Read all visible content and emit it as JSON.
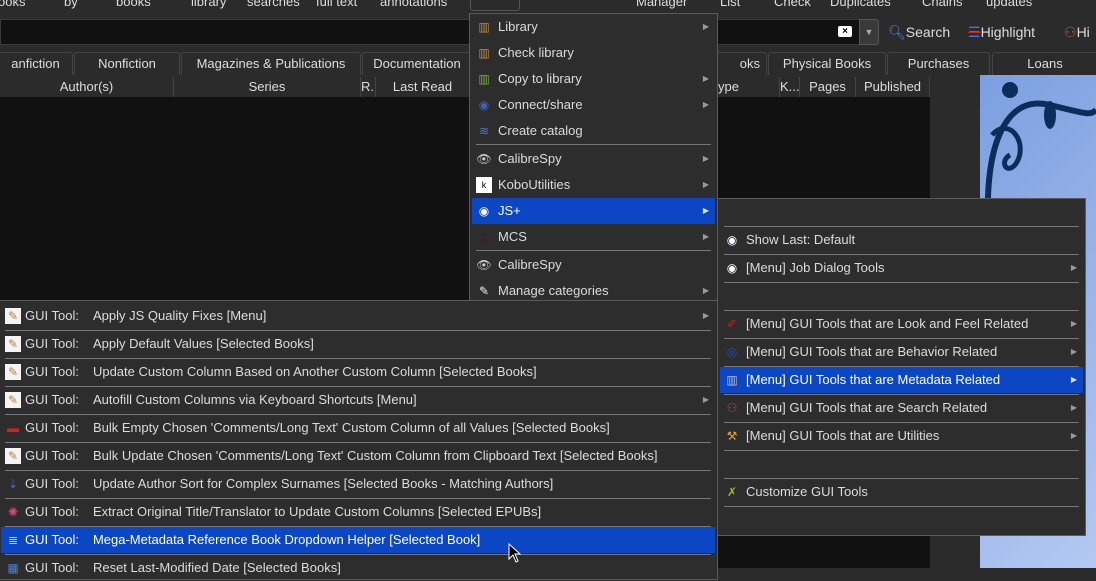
{
  "toolbar": {
    "items": [
      "ooks",
      "by",
      "books",
      "library",
      "searches",
      "full text",
      "annotations",
      "Manager",
      "List",
      "Check",
      "Duplicates",
      "Chains",
      "updates"
    ],
    "search_label": "Search",
    "highlight_label": "Highlight",
    "hi_label": "Hi",
    "clear_icon": "clear-x-icon"
  },
  "tabs": [
    "anfiction",
    "Nonfiction",
    "Magazines & Publications",
    "Documentation",
    "oks",
    "Physical Books",
    "Purchases",
    "Loans"
  ],
  "columns": [
    "Author(s)",
    "Series",
    "R...",
    "Last Read",
    "ype",
    "K...",
    "Pages",
    "Published"
  ],
  "main_menu": [
    {
      "label": "Library",
      "icon": "library-icon",
      "submenu": true
    },
    {
      "label": "Check library",
      "icon": "library-icon"
    },
    {
      "label": "Copy to library",
      "icon": "copy-library-icon",
      "submenu": true
    },
    {
      "label": "Connect/share",
      "icon": "connect-icon",
      "submenu": true
    },
    {
      "label": "Create catalog",
      "icon": "catalog-icon"
    },
    {
      "label": "CalibreSpy",
      "icon": "spy-icon",
      "submenu": true
    },
    {
      "label": "KoboUtilities",
      "icon": "kobo-icon",
      "submenu": true
    },
    {
      "label": "JS+",
      "icon": "eye-icon",
      "submenu": true,
      "selected": true
    },
    {
      "label": "MCS",
      "icon": "mcs-icon",
      "submenu": true
    },
    {
      "label": "CalibreSpy",
      "icon": "spy-icon"
    },
    {
      "label": "Manage categories",
      "icon": "tag-icon",
      "submenu": true
    }
  ],
  "jsplus_menu": [
    {
      "label": "Show Last: Default",
      "icon": "eye-icon"
    },
    {
      "label": "[Menu] Job Dialog Tools",
      "icon": "eye-icon",
      "submenu": true
    },
    {
      "label": "[Menu] GUI Tools that are Look and Feel Related",
      "icon": "brush-icon",
      "submenu": true
    },
    {
      "label": "[Menu] GUI Tools that are Behavior Related",
      "icon": "behavior-icon",
      "submenu": true
    },
    {
      "label": "[Menu] GUI Tools that are Metadata Related",
      "icon": "column-icon",
      "submenu": true,
      "selected": true
    },
    {
      "label": "[Menu] GUI Tools that are Search Related",
      "icon": "binoculars-icon",
      "submenu": true
    },
    {
      "label": "[Menu] GUI Tools that are Utilities",
      "icon": "tools-icon",
      "submenu": true
    },
    {
      "label": "Customize GUI Tools",
      "icon": "customize-icon"
    }
  ],
  "gui_menu": {
    "prefix": "GUI Tool:",
    "items": [
      {
        "label": "Apply JS Quality Fixes [Menu]",
        "icon": "pencil-icon",
        "submenu": true
      },
      {
        "label": "Apply Default Values [Selected Books]",
        "icon": "pencil-icon"
      },
      {
        "label": "Update Custom Column Based on Another Custom Column [Selected Books]",
        "icon": "pencil-icon"
      },
      {
        "label": "Autofill Custom Columns via Keyboard Shortcuts [Menu]",
        "icon": "pencil-icon",
        "submenu": true
      },
      {
        "label": "Bulk Empty Chosen 'Comments/Long Text' Custom Column of all Values [Selected Books]",
        "icon": "eraser-icon"
      },
      {
        "label": "Bulk Update Chosen 'Comments/Long Text' Custom Column from Clipboard Text [Selected Books]",
        "icon": "pencil-icon"
      },
      {
        "label": "Update Author Sort for Complex Surnames [Selected Books - Matching Authors]",
        "icon": "sort-icon"
      },
      {
        "label": "Extract Original Title/Translator to Update Custom Columns [Selected EPUBs]",
        "icon": "color-wheel-icon"
      },
      {
        "label": "Mega-Metadata Reference Book Dropdown Helper [Selected Book]",
        "icon": "dropdown-icon",
        "selected": true
      },
      {
        "label": "Reset Last-Modified Date [Selected Books]",
        "icon": "calendar-icon"
      }
    ]
  },
  "colors": {
    "highlight": "#0b46c4",
    "menu_bg": "#2d2d2d",
    "list_bg": "#111111"
  }
}
